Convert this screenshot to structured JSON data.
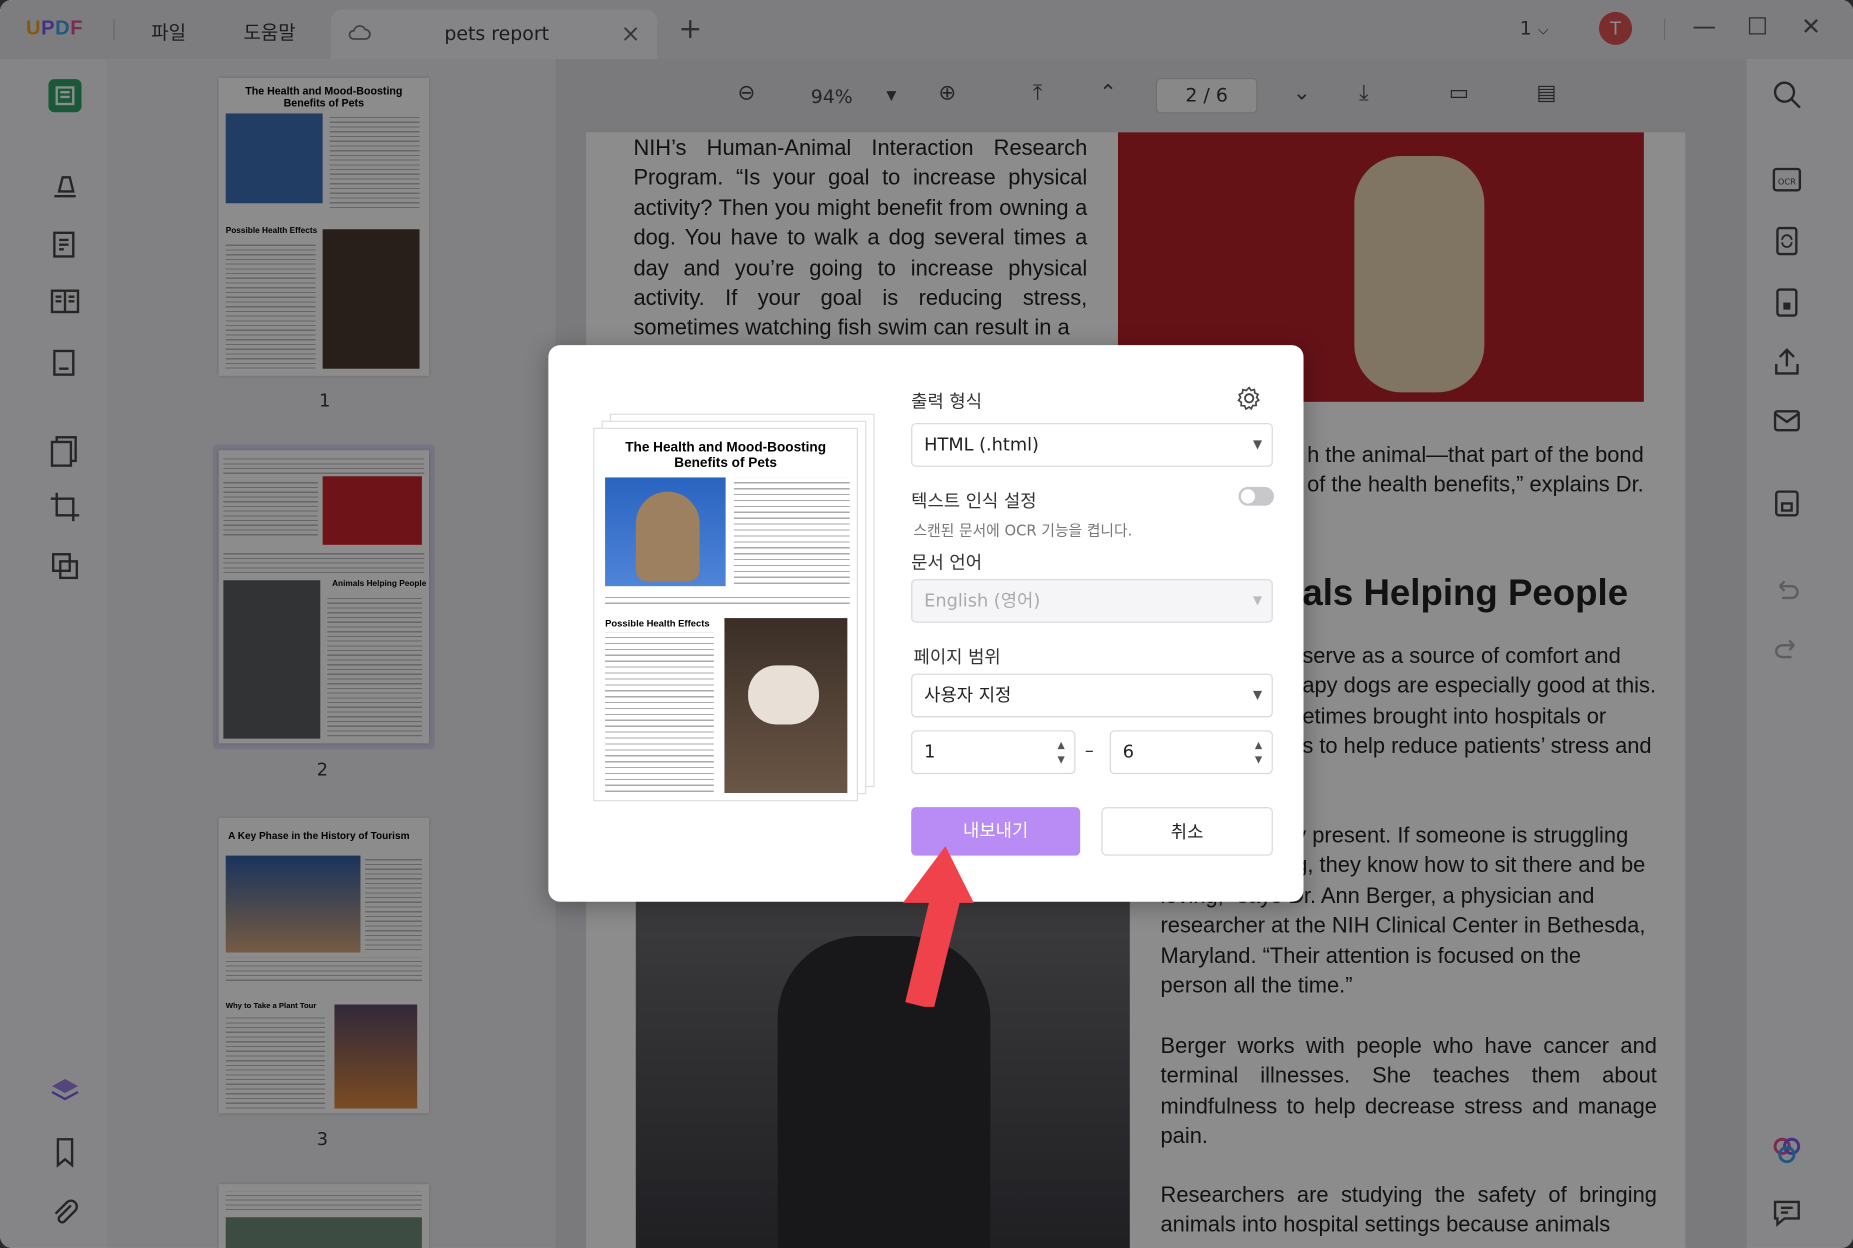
{
  "app": {
    "logo": "UPDF",
    "menu_file": "파일",
    "menu_help": "도움말",
    "tab_title": "pets report",
    "page_selector": "1",
    "avatar_letter": "T"
  },
  "toolbar": {
    "zoom": "94%",
    "current_page": "2",
    "page_sep": "/",
    "total_pages": "6"
  },
  "thumbnails": [
    {
      "label": "1",
      "title": "The Health and Mood-Boosting Benefits of Pets",
      "section": "Possible Health Effects"
    },
    {
      "label": "2",
      "section": "Animals Helping People"
    },
    {
      "label": "3",
      "title": "A Key Phase in the History of Tourism",
      "section": "Why to Take a Plant Tour"
    }
  ],
  "document": {
    "para1": "NIH’s Human-Animal Interaction Research Program. “Is your goal to increase physical activity? Then you might benefit from owning a dog. You have to walk a dog several times a day and you’re going to increase physical activity. If your goal is reducing stress, sometimes watching fish swim can result in a",
    "para2a": "h the animal—that part of the bond",
    "para2b": "of the health benefits,” explains Dr.",
    "heading": "als Helping People",
    "para3": [
      " serve as a source of comfort and",
      "apy dogs are especially good at this.",
      "etimes brought into hospitals or",
      "s to help reduce patients’ stress and"
    ],
    "para4": [
      " y present. If someone is struggling",
      " g, they know how to sit there and be",
      "loving,” says Dr. Ann Berger, a physician and",
      "researcher at the NIH Clinical Center in Bethesda,",
      "Maryland. “Their attention is focused on the",
      "person all the time.”"
    ],
    "para5": "Berger works with people who have cancer and terminal illnesses. She teaches them about mindfulness to help decrease stress and manage pain.",
    "para6": "Researchers are studying the safety of bringing animals into hospital settings because animals"
  },
  "dialog": {
    "output_format_label": "출력 형식",
    "output_format_value": "HTML (.html)",
    "ocr_label": "텍스트 인식 설정",
    "ocr_sub": "스캔된 문서에 OCR 기능을 켭니다.",
    "doc_lang_label": "문서 언어",
    "doc_lang_value": "English (영어)",
    "page_range_label": "페이지 범위",
    "page_range_value": "사용자 지정",
    "range_from": "1",
    "range_dash": "–",
    "range_to": "6",
    "export_label": "내보내기",
    "cancel_label": "취소",
    "preview_title": "The Health and Mood-Boosting Benefits of Pets",
    "preview_section": "Possible Health Effects"
  },
  "colors": {
    "accent": "#b98cf5",
    "arrow": "#f0424a"
  }
}
